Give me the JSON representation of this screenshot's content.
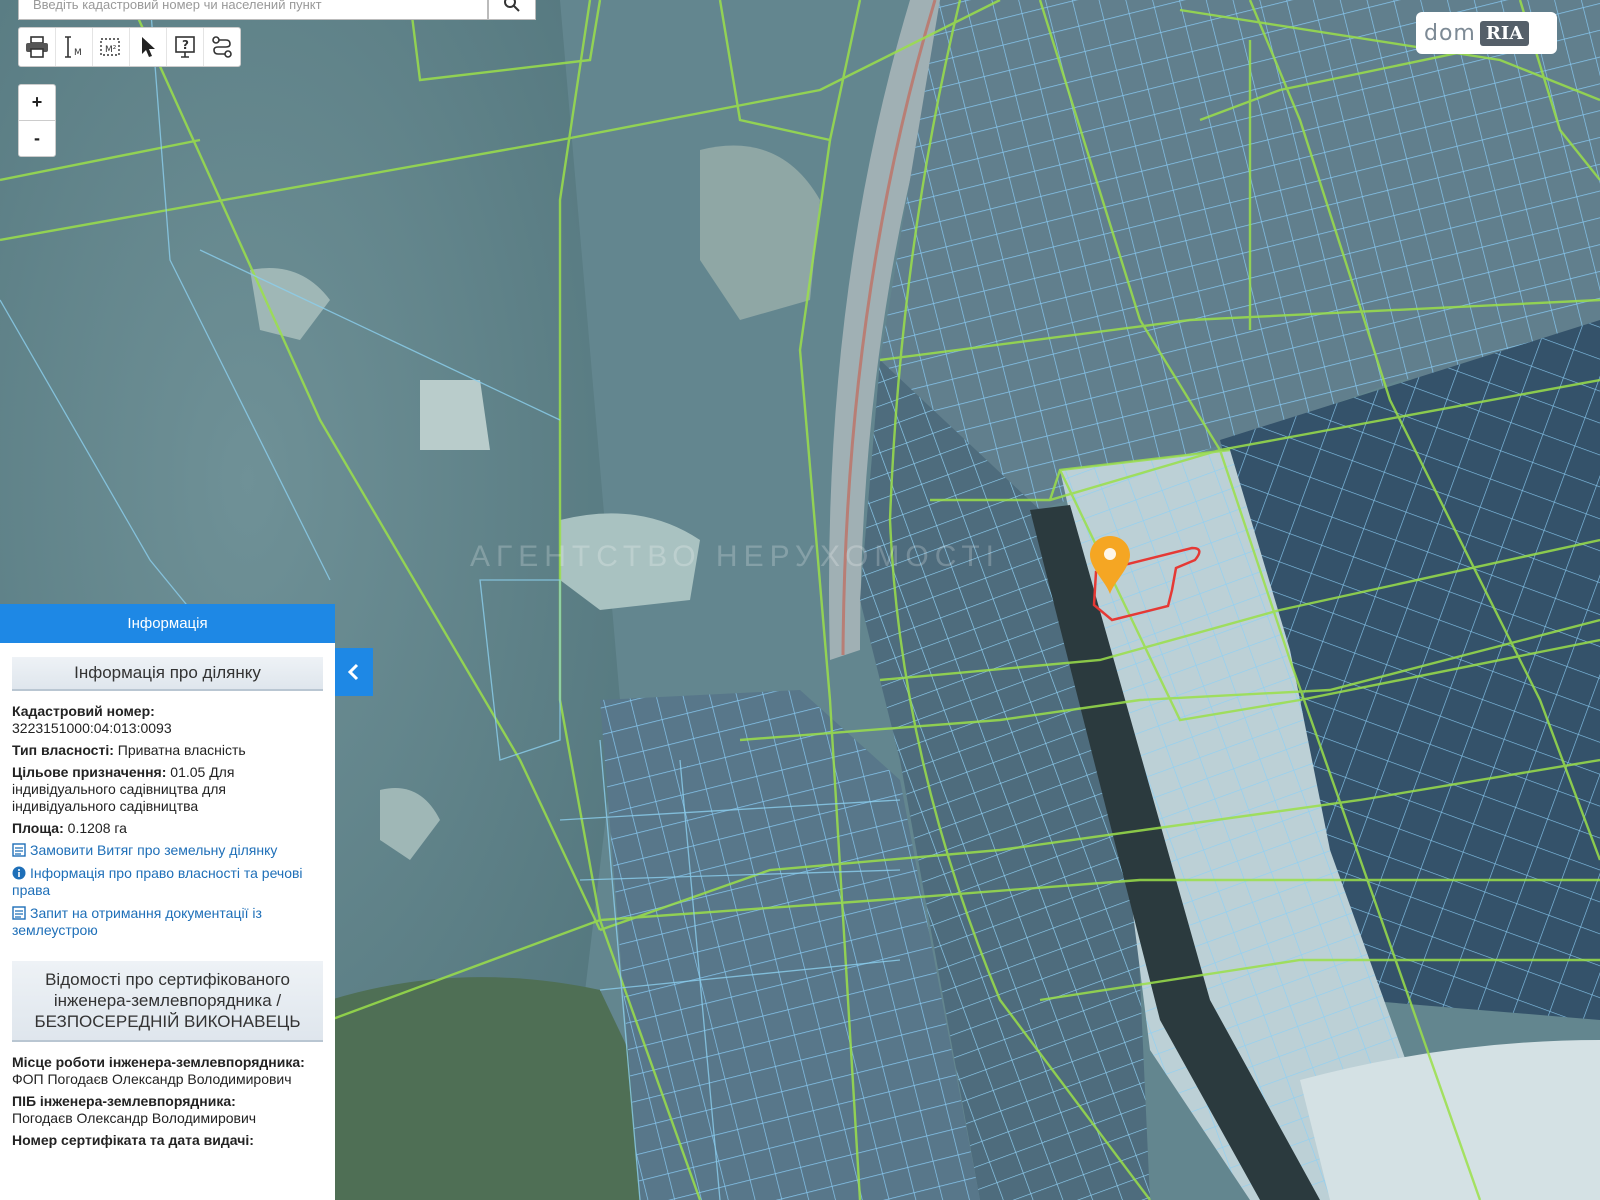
{
  "search": {
    "placeholder": "Введіть кадастровий номер чи населений пункт"
  },
  "toolbar": {
    "icons": [
      "printer-icon",
      "measure-distance-icon",
      "measure-area-icon",
      "pointer-icon",
      "info-icon",
      "route-icon"
    ]
  },
  "zoom": {
    "in_label": "+",
    "out_label": "-"
  },
  "logo": {
    "left": "dom",
    "right": "RIA"
  },
  "watermark": {
    "agency": "АГЕНТСТВО НЕРУХОМОСТІ"
  },
  "colors": {
    "panel_header": "#1e88e5",
    "parcel_highlight": "#e53935",
    "marker": "#f5a623",
    "boundary_green": "#9be04a",
    "parcel_blue": "#7fc4ee"
  },
  "panel": {
    "header": "Інформація",
    "section1_title": "Інформація про ділянку",
    "cadastral_label": "Кадастровий номер:",
    "cadastral_value": "3223151000:04:013:0093",
    "ownership_label": "Тип власності:",
    "ownership_value": "Приватна власність",
    "purpose_label": "Цільове призначення:",
    "purpose_value": "01.05 Для індивідуального садівництва для індивідуального садівництва",
    "area_label": "Площа:",
    "area_value": "0.1208 га",
    "link_order": "Замовити Витяг про земельну ділянку",
    "link_rights": "Інформація про право власності та речові права",
    "link_request": "Запит на отримання документації із землеустрою",
    "section2_title": "Відомості про сертифікованого інженера-землевпорядника / БЕЗПОСЕРЕДНІЙ ВИКОНАВЕЦЬ",
    "workplace_label": "Місце роботи інженера-землевпорядника:",
    "workplace_value": "ФОП Погодаєв Олександр Володимирович",
    "engineer_label": "ПІБ інженера-землевпорядника:",
    "engineer_value": "Погодаєв Олександр Володимирович",
    "certificate_label": "Номер сертифіката та дата видачі:"
  }
}
